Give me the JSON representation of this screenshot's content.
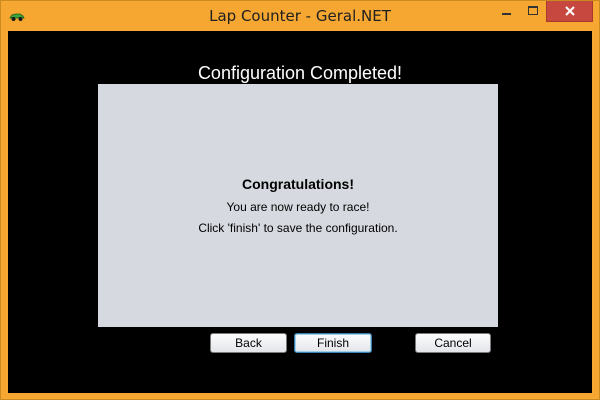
{
  "window": {
    "title": "Lap Counter - Geral.NET",
    "app_icon": "race-car-icon",
    "controls": [
      "minimize-icon",
      "maximize-icon",
      "close-icon"
    ],
    "frame_color": "#f5a731",
    "close_color": "#c7483f"
  },
  "wizard": {
    "heading": "Configuration Completed!",
    "panel": {
      "title": "Congratulations!",
      "line1": "You are now ready to race!",
      "line2": "Click 'finish' to save the configuration."
    },
    "buttons": {
      "back": "Back",
      "finish": "Finish",
      "cancel": "Cancel"
    }
  }
}
